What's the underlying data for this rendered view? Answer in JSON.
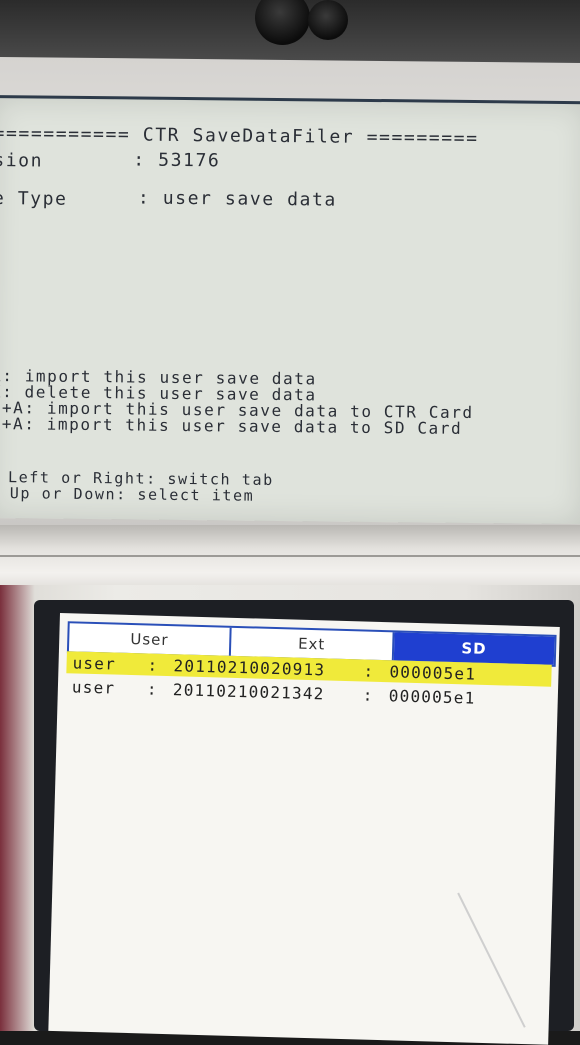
{
  "top_screen": {
    "title_line": "=========== CTR SaveDataFiler =========",
    "version_label": "sion",
    "version_value": ": 53176",
    "type_label": "e Type",
    "type_value": ": user save data",
    "actions": [
      "A: import this user save data",
      "X: delete this user save data",
      "L+A: import this user save data to CTR Card",
      "R+A: import this user save data to SD Card"
    ],
    "hints": [
      "Left or Right: switch tab",
      "Up or Down: select item"
    ]
  },
  "bottom_screen": {
    "tabs": [
      {
        "label": "User",
        "active": false
      },
      {
        "label": "Ext",
        "active": false
      },
      {
        "label": "SD",
        "active": true
      }
    ],
    "rows": [
      {
        "type": "user",
        "sep1": ":",
        "date": "20110210020913",
        "sep2": ":",
        "id": "000005e1",
        "selected": true
      },
      {
        "type": "user",
        "sep1": ":",
        "date": "20110210021342",
        "sep2": ":",
        "id": "000005e1",
        "selected": false
      }
    ]
  },
  "colors": {
    "tab_active": "#1f3fd0",
    "tab_border": "#2a4fb8",
    "selection": "#f0ea3a"
  }
}
